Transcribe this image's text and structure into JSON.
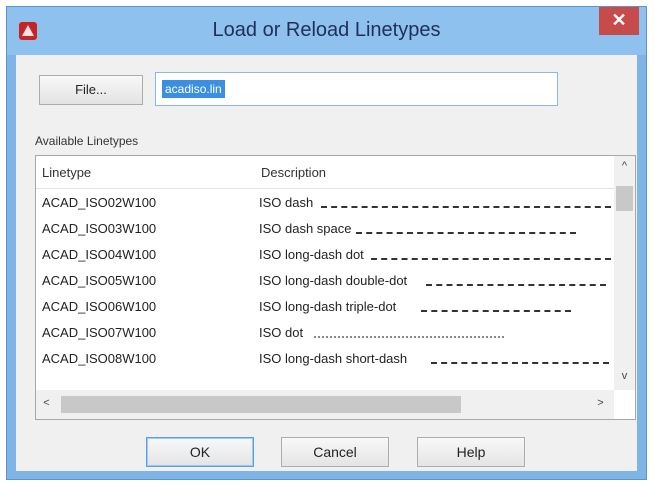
{
  "window": {
    "title": "Load or Reload Linetypes",
    "close_label": "✕"
  },
  "file_button": {
    "label": "File..."
  },
  "file_input": {
    "value": "acadiso.lin"
  },
  "list": {
    "label": "Available Linetypes",
    "columns": [
      "Linetype",
      "Description"
    ],
    "rows": [
      {
        "name": "ACAD_ISO02W100",
        "description": "ISO dash"
      },
      {
        "name": "ACAD_ISO03W100",
        "description": "ISO dash space"
      },
      {
        "name": "ACAD_ISO04W100",
        "description": "ISO long-dash dot"
      },
      {
        "name": "ACAD_ISO05W100",
        "description": "ISO long-dash double-dot"
      },
      {
        "name": "ACAD_ISO06W100",
        "description": "ISO long-dash triple-dot"
      },
      {
        "name": "ACAD_ISO07W100",
        "description": "ISO dot"
      },
      {
        "name": "ACAD_ISO08W100",
        "description": "ISO long-dash short-dash"
      }
    ]
  },
  "buttons": {
    "ok": "OK",
    "cancel": "Cancel",
    "help": "Help"
  },
  "scroll": {
    "up": "^",
    "down": "v",
    "left": "<",
    "right": ">"
  },
  "colors": {
    "titlebar": "#8fc1ef",
    "selection": "#3a8fe3",
    "close": "#c84b4b"
  }
}
